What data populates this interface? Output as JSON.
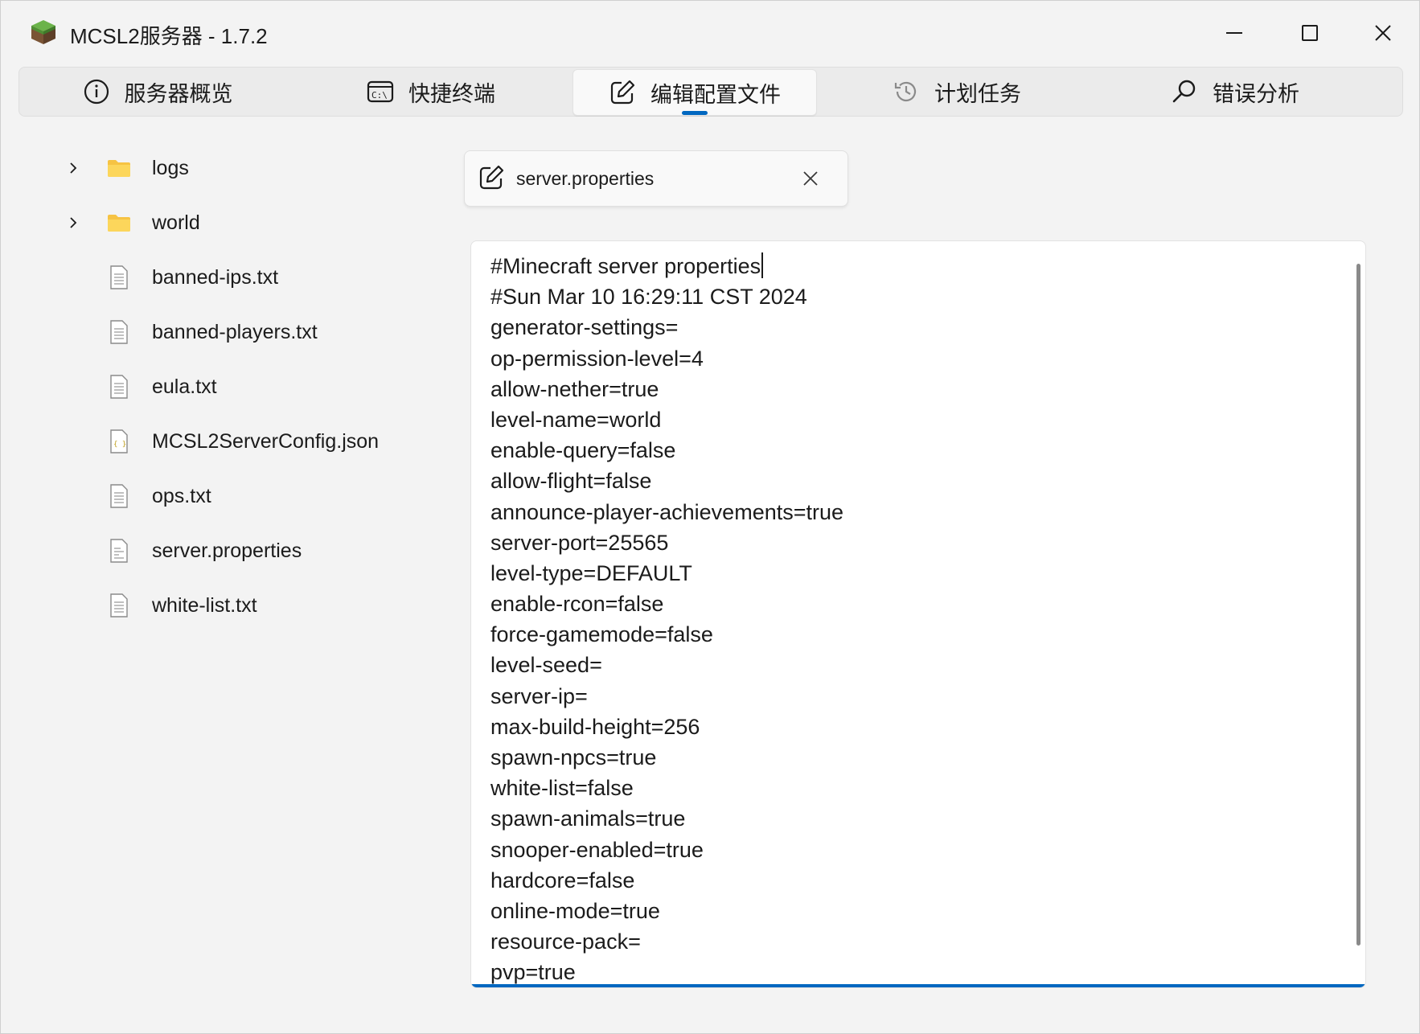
{
  "window": {
    "title": "MCSL2服务器 - 1.7.2",
    "icon": "grass-block-icon",
    "controls": [
      "minimize-icon",
      "maximize-icon",
      "close-icon"
    ]
  },
  "tabs": [
    {
      "label": "服务器概览",
      "icon": "info-icon",
      "active": false
    },
    {
      "label": "快捷终端",
      "icon": "terminal-icon",
      "active": false
    },
    {
      "label": "编辑配置文件",
      "icon": "edit-icon",
      "active": true
    },
    {
      "label": "计划任务",
      "icon": "history-icon",
      "active": false
    },
    {
      "label": "错误分析",
      "icon": "search-icon",
      "active": false
    }
  ],
  "file_tree": [
    {
      "name": "logs",
      "type": "folder",
      "expandable": true
    },
    {
      "name": "world",
      "type": "folder",
      "expandable": true
    },
    {
      "name": "banned-ips.txt",
      "type": "text"
    },
    {
      "name": "banned-players.txt",
      "type": "text"
    },
    {
      "name": "eula.txt",
      "type": "text"
    },
    {
      "name": "MCSL2ServerConfig.json",
      "type": "json"
    },
    {
      "name": "ops.txt",
      "type": "text"
    },
    {
      "name": "server.properties",
      "type": "properties"
    },
    {
      "name": "white-list.txt",
      "type": "text"
    }
  ],
  "editor": {
    "open_file": "server.properties",
    "lines": [
      "#Minecraft server properties",
      "#Sun Mar 10 16:29:11 CST 2024",
      "generator-settings=",
      "op-permission-level=4",
      "allow-nether=true",
      "level-name=world",
      "enable-query=false",
      "allow-flight=false",
      "announce-player-achievements=true",
      "server-port=25565",
      "level-type=DEFAULT",
      "enable-rcon=false",
      "force-gamemode=false",
      "level-seed=",
      "server-ip=",
      "max-build-height=256",
      "spawn-npcs=true",
      "white-list=false",
      "spawn-animals=true",
      "snooper-enabled=true",
      "hardcore=false",
      "online-mode=true",
      "resource-pack=",
      "pvp=true"
    ]
  },
  "colors": {
    "accent": "#0067c0",
    "folder": "#f6c343",
    "background": "#f3f3f3"
  }
}
